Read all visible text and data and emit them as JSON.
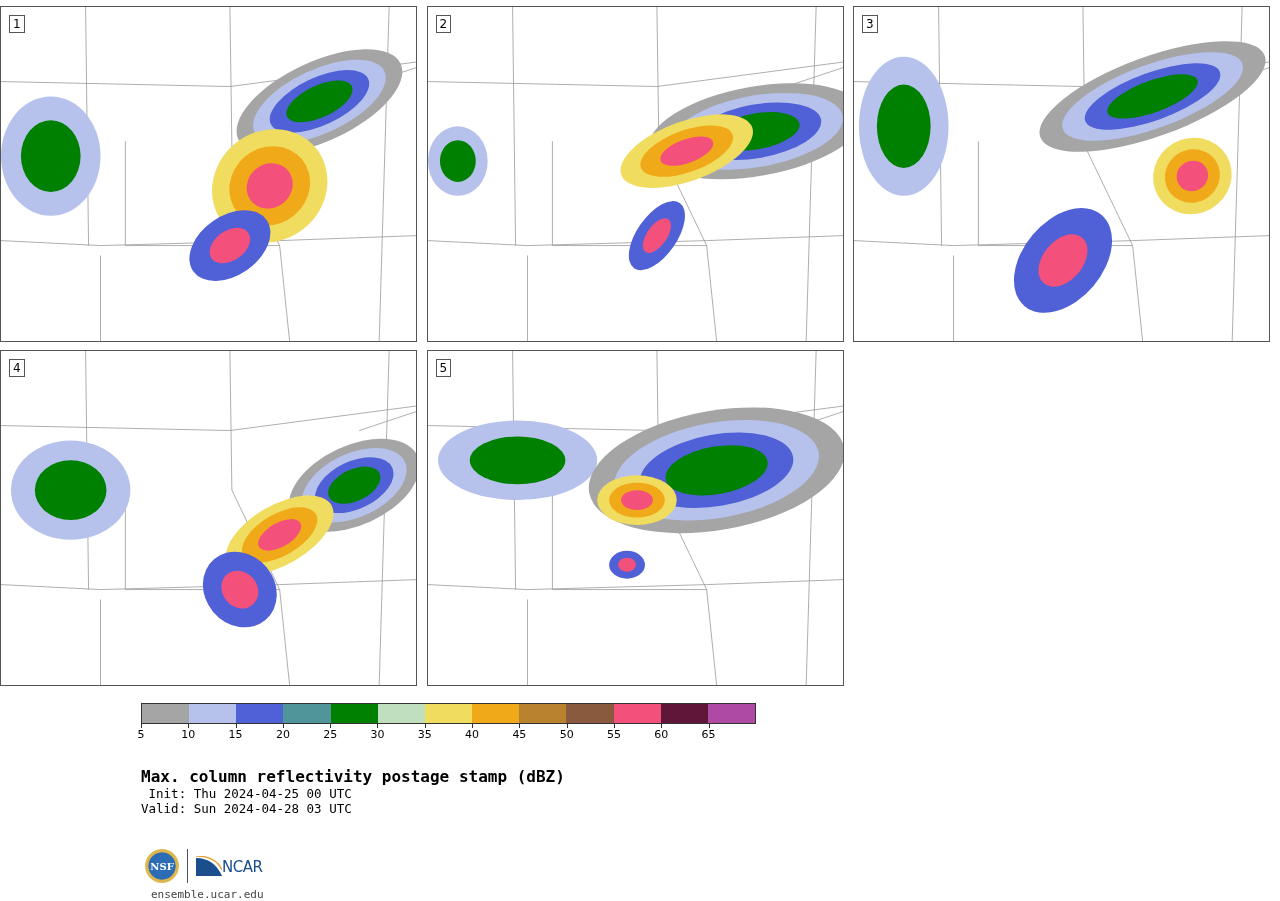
{
  "panels": [
    {
      "label": "1"
    },
    {
      "label": "2"
    },
    {
      "label": "3"
    },
    {
      "label": "4"
    },
    {
      "label": "5"
    }
  ],
  "colorbar": {
    "bins": [
      {
        "color": "#a5a5a5"
      },
      {
        "color": "#b6c2ec"
      },
      {
        "color": "#5060d6"
      },
      {
        "color": "#4f9599"
      },
      {
        "color": "#008000"
      },
      {
        "color": "#bfdfbf"
      },
      {
        "color": "#f0dc5f"
      },
      {
        "color": "#f0aa19"
      },
      {
        "color": "#b8822f"
      },
      {
        "color": "#8a5a3e"
      },
      {
        "color": "#f4507c"
      },
      {
        "color": "#601638"
      },
      {
        "color": "#ae4aa4"
      }
    ],
    "ticks": [
      "5",
      "10",
      "15",
      "20",
      "25",
      "30",
      "35",
      "40",
      "45",
      "50",
      "55",
      "60",
      "65"
    ]
  },
  "title": "Max. column reflectivity postage stamp (dBZ)",
  "init": " Init: Thu 2024-04-25 00 UTC",
  "valid": "Valid: Sun 2024-04-28 03 UTC",
  "logos": {
    "nsf": "NSF",
    "ncar": "NCAR"
  },
  "link": "ensemble.ucar.edu"
}
